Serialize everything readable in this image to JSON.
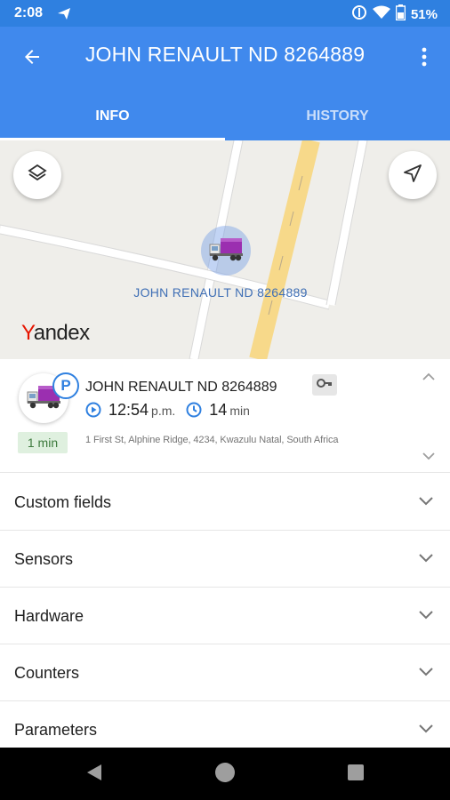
{
  "status_bar": {
    "time": "2:08",
    "battery_text": "51%",
    "icons": [
      "navigation-arrow-icon",
      "data-saver-icon",
      "wifi-icon",
      "battery-icon"
    ]
  },
  "app_bar": {
    "title": "JOHN RENAULT ND 8264889",
    "back_icon": "arrow-left-icon",
    "menu_icon": "more-vert-icon",
    "color": "#4089ed",
    "tabs": [
      {
        "label": "INFO",
        "active": true
      },
      {
        "label": "HISTORY",
        "active": false
      }
    ]
  },
  "map": {
    "marker_label": "JOHN RENAULT ND 8264889",
    "provider": "Yandex",
    "provider_first_letter": "Y",
    "provider_rest": "andex",
    "buttons": [
      "layers-icon",
      "navigation-icon"
    ]
  },
  "unit": {
    "name": "JOHN RENAULT ND 8264889",
    "status_badge": "P",
    "time_value": "12:54",
    "time_suffix": "p.m.",
    "duration_value": "14",
    "duration_unit": "min",
    "parked_duration": "1 min",
    "address": "1 First St, Alphine Ridge, 4234, Kwazulu Natal, South Africa",
    "key_icon": "key-icon"
  },
  "sections": [
    {
      "label": "Custom fields"
    },
    {
      "label": "Sensors"
    },
    {
      "label": "Hardware"
    },
    {
      "label": "Counters"
    },
    {
      "label": "Parameters"
    }
  ],
  "colors": {
    "primary": "#4089ed",
    "status_bar": "#2f80e0",
    "road_main": "#f7d98a",
    "parked_badge_bg": "#dff0df",
    "truck": "#9b2fb0"
  }
}
